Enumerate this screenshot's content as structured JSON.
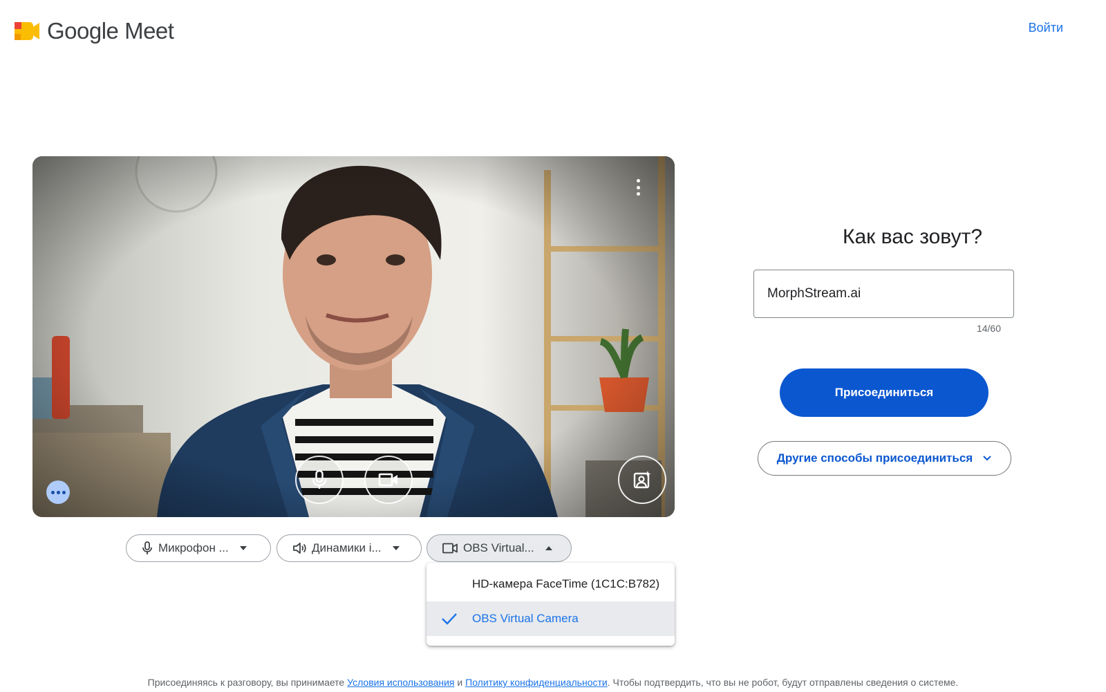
{
  "header": {
    "app_name": "Google Meet",
    "sign_in": "Войти"
  },
  "devices": {
    "microphone": "Микрофон ...",
    "speakers": "Динамики i...",
    "camera": "OBS Virtual..."
  },
  "camera_menu": {
    "items": [
      {
        "label": "HD-камера FaceTime (1C1C:B782)",
        "selected": false
      },
      {
        "label": "OBS Virtual Camera",
        "selected": true
      }
    ]
  },
  "join_panel": {
    "question": "Как вас зовут?",
    "name_value": "MorphStream.ai",
    "char_counter": "14/60",
    "join_label": "Присоединиться",
    "other_ways_label": "Другие способы присоединиться"
  },
  "footer": {
    "text_before": "Присоединяясь к разговору, вы принимаете ",
    "terms_link": "Условия использования",
    "and": " и ",
    "privacy_link": "Политику конфиденциальности",
    "text_after": ". Чтобы подтвердить, что вы не робот, будут отправлены сведения о системе."
  },
  "colors": {
    "primary": "#0b57d0",
    "link": "#1a73e8",
    "effects_bg": "#aecbfa"
  }
}
